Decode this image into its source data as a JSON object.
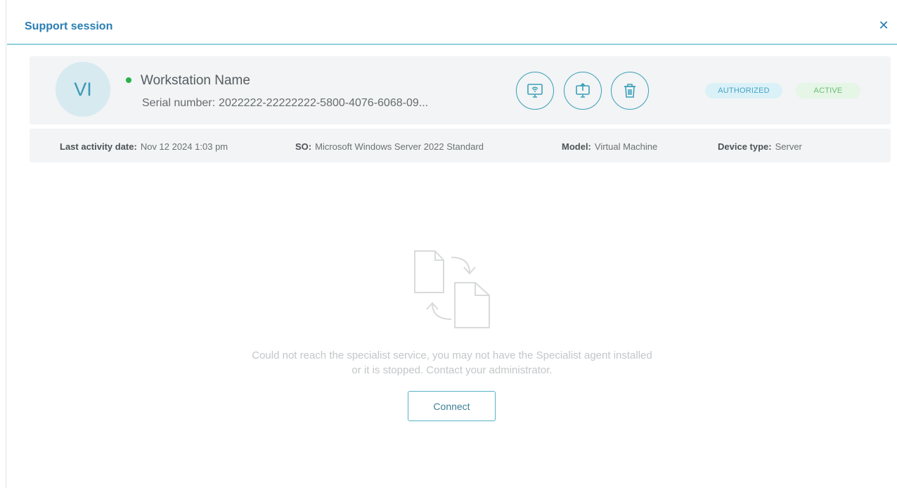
{
  "dialog": {
    "title": "Support session",
    "close_icon": "close-icon"
  },
  "device": {
    "initials": "VI",
    "status": "online",
    "name": "Workstation Name",
    "serial_label": "Serial number:",
    "serial_value": "2022222-22222222-5800-4076-6068-09...",
    "actions": [
      {
        "name": "remote-desktop",
        "icon": "remote-screen-icon"
      },
      {
        "name": "file-transfer",
        "icon": "upload-screen-icon"
      },
      {
        "name": "delete",
        "icon": "trash-icon"
      }
    ],
    "badges": {
      "authorized": "AUTHORIZED",
      "active": "ACTIVE"
    }
  },
  "info": {
    "last_activity_label": "Last activity date:",
    "last_activity_value": "Nov 12 2024 1:03 pm",
    "os_label": "SO:",
    "os_value": "Microsoft Windows Server 2022 Standard",
    "model_label": "Model:",
    "model_value": "Virtual Machine",
    "device_type_label": "Device type:",
    "device_type_value": "Server"
  },
  "empty_state": {
    "icon": "file-transfer-icon",
    "message_line1": "Could not reach the specialist service, you may not have the Specialist agent installed",
    "message_line2": "or it is stopped. Contact your administrator.",
    "connect_label": "Connect"
  },
  "colors": {
    "accent": "#2a7db2",
    "teal": "#3b9fb8",
    "status_online": "#27b24a",
    "panel_bg": "#f2f4f5"
  }
}
